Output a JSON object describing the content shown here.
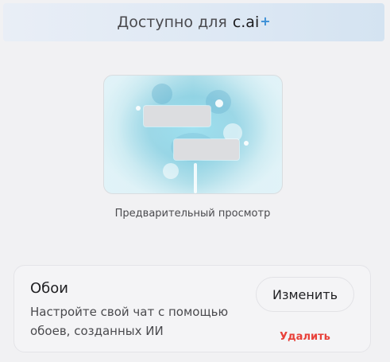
{
  "banner": {
    "text": "Доступно для",
    "brand": "c.ai",
    "plus": "+"
  },
  "preview": {
    "caption": "Предварительный просмотр"
  },
  "wallpaper": {
    "title": "Обои",
    "description": "Настройте свой чат с помощью обоев, созданных ИИ",
    "change_label": "Изменить",
    "delete_label": "Удалить"
  },
  "colors": {
    "accent": "#3b8fd6",
    "danger": "#e8413a"
  }
}
